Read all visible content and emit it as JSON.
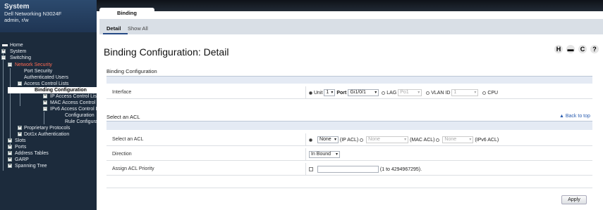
{
  "sidebar": {
    "title": "System",
    "device": "Dell Networking N3024F",
    "user": "admin, r/w",
    "tree": [
      {
        "label": "Home"
      },
      {
        "label": "System"
      },
      {
        "label": "Switching"
      },
      {
        "label": "Network Security"
      },
      {
        "label": "Port Security"
      },
      {
        "label": "Authenticated Users"
      },
      {
        "label": "Access Control Lists"
      },
      {
        "label": "Binding Configuration"
      },
      {
        "label": "IP Access Control Lists"
      },
      {
        "label": "MAC Access Control Lists"
      },
      {
        "label": "IPv6 Access Control Lists"
      },
      {
        "label": "Configuration"
      },
      {
        "label": "Rule Configuration"
      },
      {
        "label": "Proprietary Protocols"
      },
      {
        "label": "Dot1x Authentication"
      },
      {
        "label": "Slots"
      },
      {
        "label": "Ports"
      },
      {
        "label": "Address Tables"
      },
      {
        "label": "GARP"
      },
      {
        "label": "Spanning Tree"
      }
    ]
  },
  "tabs": {
    "main": "Binding Configuration",
    "sub_detail": "Detail",
    "sub_showall": "Show All"
  },
  "page_title": "Binding Configuration: Detail",
  "title_icons": [
    {
      "icon": "help-icon",
      "glyph": "H"
    },
    {
      "icon": "print-icon",
      "glyph": "▬"
    },
    {
      "icon": "refresh-icon",
      "glyph": "C"
    },
    {
      "icon": "question-icon",
      "glyph": "?"
    }
  ],
  "binding": {
    "heading": "Binding Configuration",
    "interface_label": "Interface",
    "unit_label": "Unit",
    "unit_value": "1",
    "port_label": "Port",
    "port_value": "Gi1/0/1",
    "lag_label": "LAG",
    "lag_value": "Po1",
    "vlan_label": "VLAN ID",
    "vlan_value": "1",
    "cpu_label": "CPU"
  },
  "acl": {
    "heading": "Select an ACL",
    "back_to_top": "▲ Back to top",
    "select_label": "Select an ACL",
    "ip_value": "None",
    "ip_suffix": "(IP ACL)",
    "mac_value": "None",
    "mac_suffix": "(MAC ACL)",
    "ipv6_value": "None",
    "ipv6_suffix": "(IPv6 ACL)",
    "direction_label": "Direction",
    "direction_value": "In Bound",
    "priority_label": "Assign ACL Priority",
    "priority_range": "(1 to 4294967295)."
  },
  "apply_label": "Apply"
}
